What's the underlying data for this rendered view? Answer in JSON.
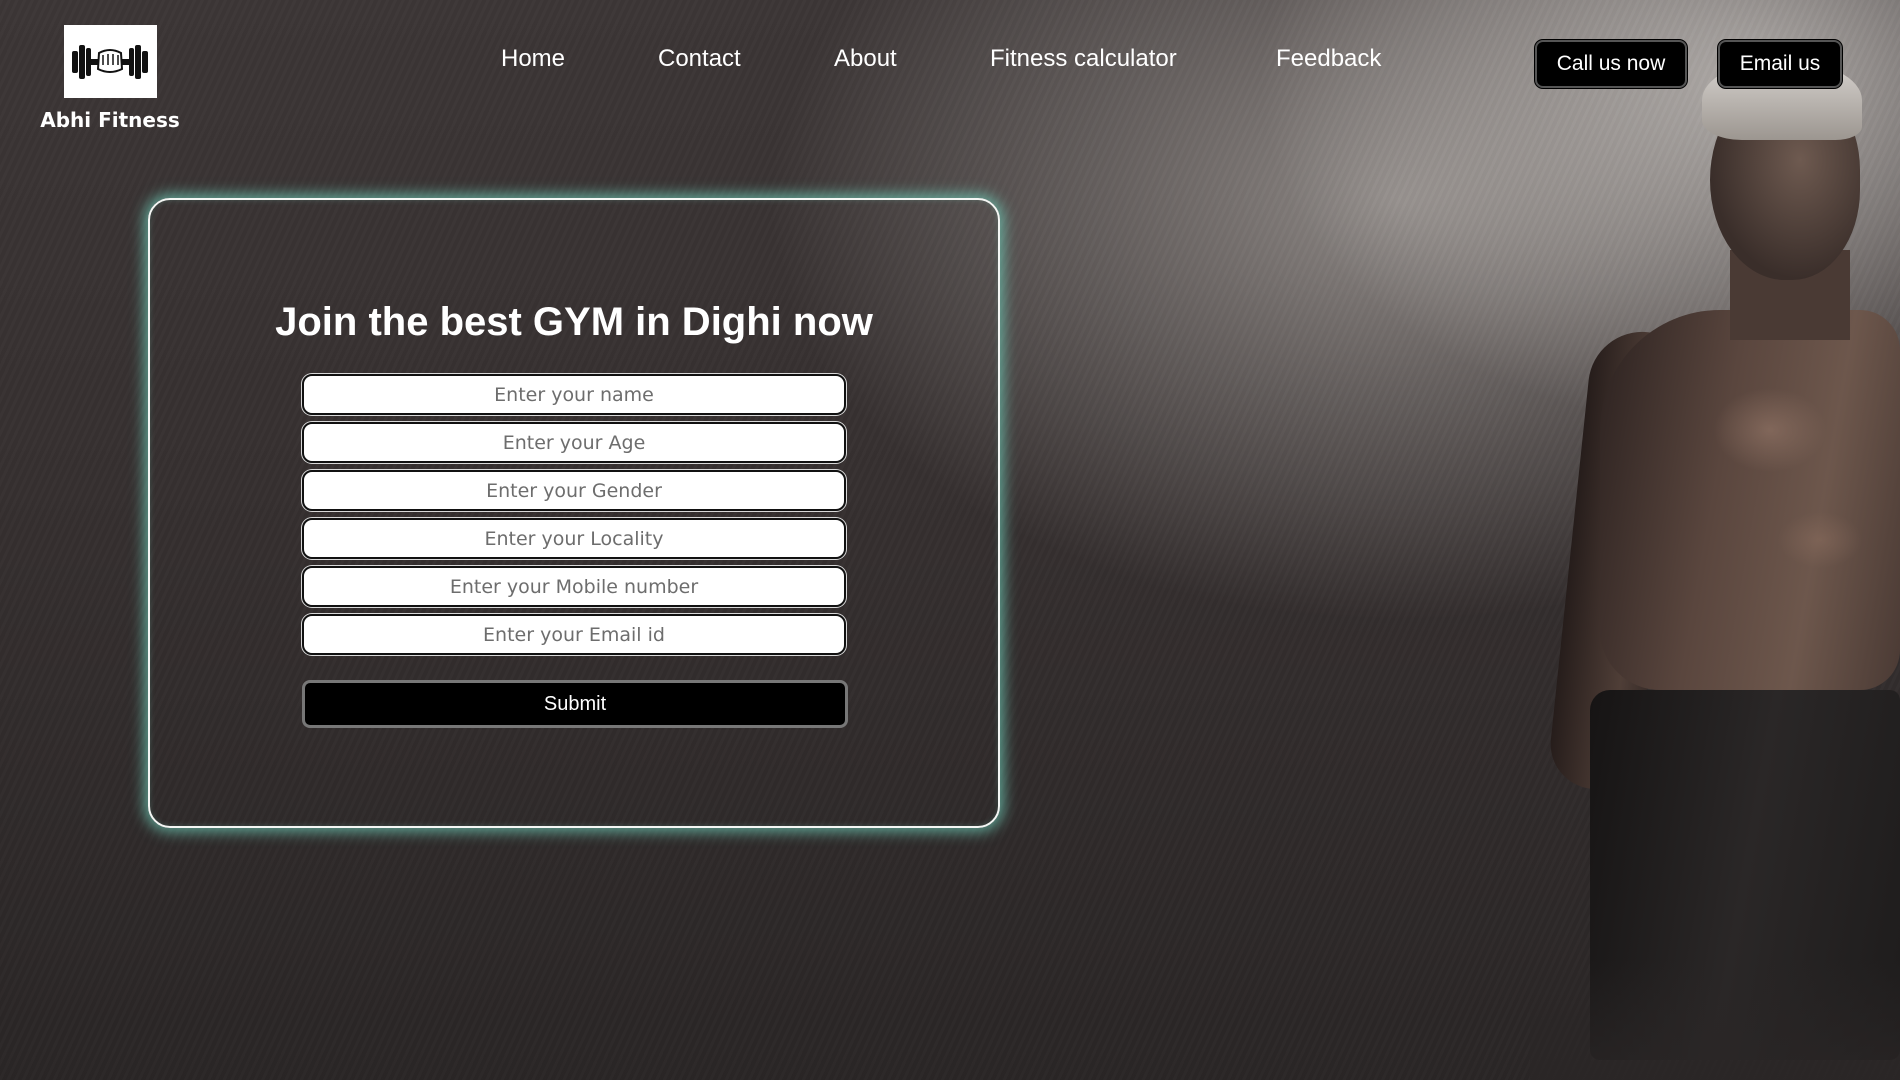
{
  "brand": {
    "name": "Abhi Fitness",
    "logo_icon": "dumbbell-fist-icon"
  },
  "nav": {
    "items": [
      {
        "label": "Home"
      },
      {
        "label": "Contact"
      },
      {
        "label": "About"
      },
      {
        "label": "Fitness calculator"
      },
      {
        "label": "Feedback"
      }
    ]
  },
  "header_actions": {
    "call_label": "Call us now",
    "email_label": "Email us"
  },
  "form": {
    "title": "Join the best GYM in Dighi now",
    "fields": [
      {
        "placeholder": "Enter your name"
      },
      {
        "placeholder": "Enter your Age"
      },
      {
        "placeholder": "Enter your Gender"
      },
      {
        "placeholder": "Enter your Locality"
      },
      {
        "placeholder": "Enter your Mobile number"
      },
      {
        "placeholder": "Enter your Email id"
      }
    ],
    "submit_label": "Submit"
  },
  "colors": {
    "card_glow": "#6ec8b4",
    "button_bg": "#000000",
    "text": "#ffffff"
  }
}
